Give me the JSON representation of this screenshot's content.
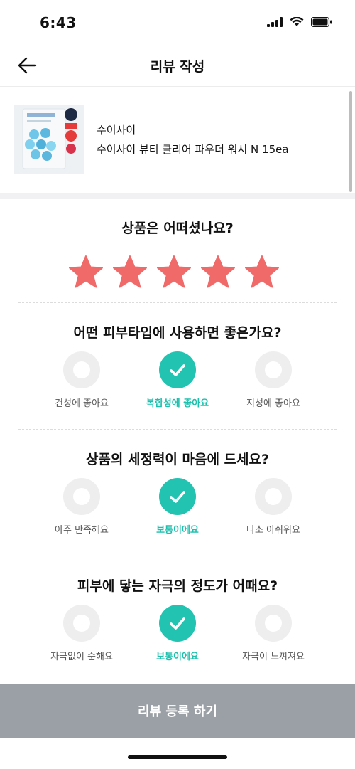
{
  "status": {
    "time": "6:43"
  },
  "header": {
    "title": "리뷰 작성"
  },
  "product": {
    "brand": "수이사이",
    "name": "수이사이 뷰티 클리어 파우더 워시 N 15ea"
  },
  "rating": {
    "question": "상품은 어떠셨나요?",
    "value": 5,
    "max": 5,
    "color": "#f06a6a"
  },
  "questions": [
    {
      "question": "어떤 피부타입에 사용하면 좋은가요?",
      "options": [
        "건성에 좋아요",
        "복합성에 좋아요",
        "지성에 좋아요"
      ],
      "selected": 1
    },
    {
      "question": "상품의 세정력이 마음에 드세요?",
      "options": [
        "아주 만족해요",
        "보통이에요",
        "다소 아쉬워요"
      ],
      "selected": 1
    },
    {
      "question": "피부에 닿는 자극의 정도가 어때요?",
      "options": [
        "자극없이 순해요",
        "보통이에요",
        "자극이 느껴져요"
      ],
      "selected": 1
    }
  ],
  "submit": {
    "label": "리뷰 등록 하기"
  },
  "colors": {
    "accent": "#22c3b0",
    "star": "#f06a6a",
    "submit_bg": "#9aa0a6"
  },
  "icons": {
    "back": "arrow-left-icon",
    "check": "check-icon",
    "signal": "signal-icon",
    "wifi": "wifi-icon",
    "battery": "battery-icon"
  }
}
